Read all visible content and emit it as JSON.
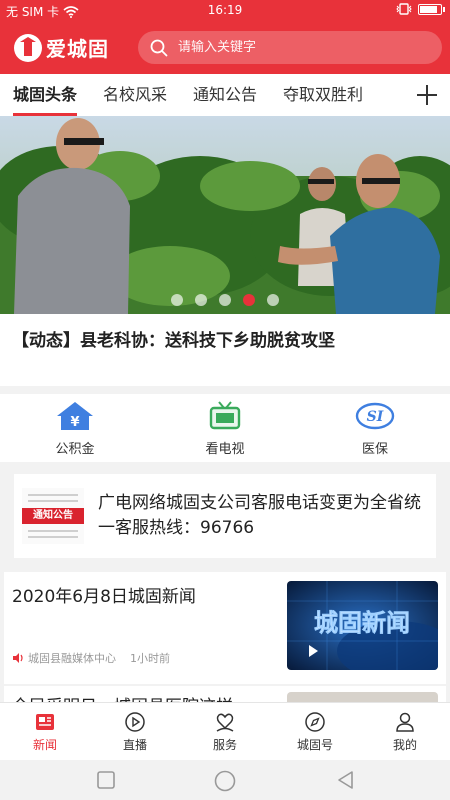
{
  "status_bar": {
    "carrier": "无 SIM 卡",
    "time": "16:19",
    "battery_level": 0.9
  },
  "header": {
    "logo_text": "爱城固",
    "search_placeholder": "请输入关键字"
  },
  "tabs": [
    {
      "label": "城固头条",
      "active": true
    },
    {
      "label": "名校风采",
      "active": false
    },
    {
      "label": "通知公告",
      "active": false
    },
    {
      "label": "夺取双胜利",
      "active": false
    }
  ],
  "banner": {
    "dots": 5,
    "active_dot": 4
  },
  "headline": "【动态】县老科协：送科技下乡助脱贫攻坚",
  "services": [
    {
      "label": "公积金",
      "icon": "housing-fund-icon",
      "glyph": "¥"
    },
    {
      "label": "看电视",
      "icon": "tv-icon"
    },
    {
      "label": "医保",
      "icon": "medical-insurance-icon",
      "glyph": "SI"
    }
  ],
  "notice": {
    "tag_label": "通知公告",
    "text": "广电网络城固支公司客服电话变更为全省统一客服热线：96766"
  },
  "news": [
    {
      "title": "2020年6月8日城固新闻",
      "source": "城固县融媒体中心",
      "time": "1小时前",
      "thumb_text": "城固新闻"
    },
    {
      "title": "全民采明日，城固县医院这样"
    }
  ],
  "bottom_nav": [
    {
      "label": "新闻",
      "icon": "news-icon",
      "active": true
    },
    {
      "label": "直播",
      "icon": "play-icon",
      "active": false
    },
    {
      "label": "服务",
      "icon": "service-icon",
      "active": false
    },
    {
      "label": "城固号",
      "icon": "compass-icon",
      "active": false
    },
    {
      "label": "我的",
      "icon": "user-icon",
      "active": false
    }
  ],
  "colors": {
    "brand_red": "#e8323a",
    "inactive_dot": "#ffffff",
    "housing_blue": "#3f7fe0",
    "tv_green": "#3aaa5c"
  }
}
